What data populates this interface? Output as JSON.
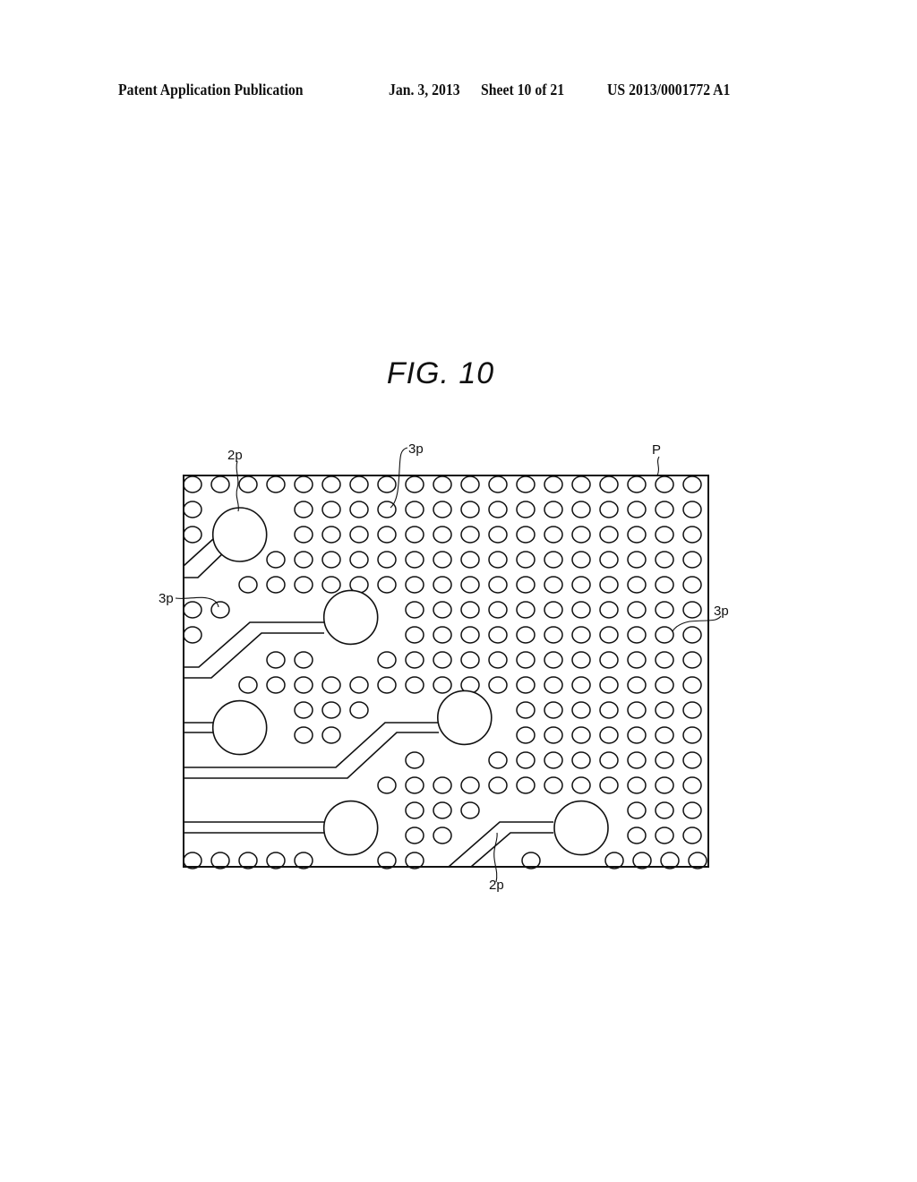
{
  "header": {
    "publication": "Patent Application Publication",
    "date": "Jan. 3, 2013",
    "sheet": "Sheet 10 of 21",
    "patent_number": "US 2013/0001772 A1"
  },
  "figure": {
    "title": "FIG.  10",
    "ink_color": "#111111",
    "labels": {
      "panel": "P",
      "pad_top": "2p",
      "hole_top": "3p",
      "hole_left": "3p",
      "hole_right": "3p",
      "pad_bottom": "2p"
    },
    "hole_grid": {
      "columns": 19,
      "rows": [
        "1111111111111111111",
        "1000111111111111111",
        "1000111111111111111",
        "0001111111111111111",
        "0011111111111111111",
        "1100000011111111111",
        "1000000011111111111",
        "0001100111111111111",
        "0011111111111111111",
        "0000111000001111111",
        "0000110000001111111",
        "0000000010011111111",
        "0000000111111111111",
        "0000000011100000111",
        "0000000011000000111",
        "1111100110001001111"
      ]
    },
    "pads": [
      {
        "name": "pad-a",
        "col": 1.7,
        "row": 2
      },
      {
        "name": "pad-b",
        "col": 5.7,
        "row": 5.3
      },
      {
        "name": "pad-c",
        "col": 1.7,
        "row": 9.7
      },
      {
        "name": "pad-d",
        "col": 9.8,
        "row": 9.3
      },
      {
        "name": "pad-e",
        "col": 5.7,
        "row": 13.7
      },
      {
        "name": "pad-f",
        "col": 14.0,
        "row": 13.7
      }
    ]
  }
}
